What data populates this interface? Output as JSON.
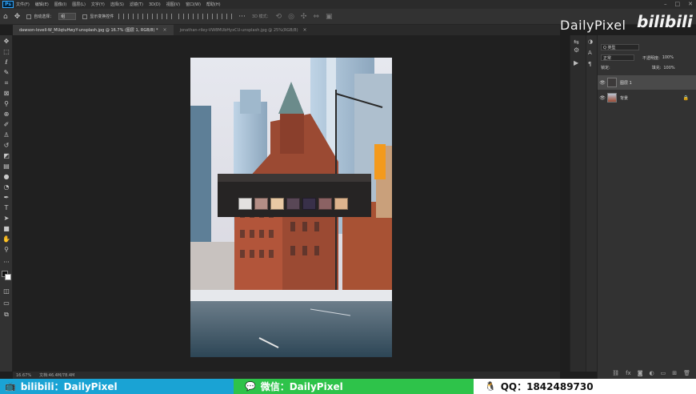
{
  "menubar": {
    "logo": "Ps",
    "items": [
      "文件(F)",
      "编辑(E)",
      "图像(I)",
      "图层(L)",
      "文字(Y)",
      "选择(S)",
      "滤镜(T)",
      "3D(D)",
      "视图(V)",
      "窗口(W)",
      "帮助(H)"
    ],
    "window_controls": [
      "–",
      "□",
      "✕"
    ]
  },
  "options": {
    "auto_select_label": "自动选择：",
    "auto_select_value": "组",
    "show_transform_label": "显示变换控件",
    "mode_3d_label": "3D 模式："
  },
  "watermark": {
    "brand": "DailyPixel",
    "bili": "bilibili"
  },
  "tabs": [
    {
      "label": "dawson-lovell-W_MUqtuHwyY-unsplash.jpg @ 16.7% (图层 1, RGB/8) *",
      "active": true
    },
    {
      "label": "jonathan-riley-VW8MUbHyxCU-unsplash.jpg @ 25%(RGB/8)",
      "active": false
    }
  ],
  "palette_colors": [
    "#e3e1e0",
    "#b48e86",
    "#e9c9a4",
    "#594756",
    "#383049",
    "#8b6263",
    "#ddb38d"
  ],
  "status": {
    "zoom": "16.67%",
    "doc": "文档:46.4M/78.4M"
  },
  "layers_panel": {
    "search_kind": "Q 类型",
    "blend_mode": "正常",
    "opacity_label": "不透明度:",
    "opacity_value": "100%",
    "lock_label": "锁定:",
    "fill_label": "填充:",
    "fill_value": "100%",
    "layers": [
      {
        "name": "图层 1",
        "selected": true
      },
      {
        "name": "背景",
        "selected": false
      }
    ],
    "footer_icons": [
      "link-icon",
      "fx-icon",
      "mask-icon",
      "adjustment-icon",
      "group-icon",
      "new-layer-icon",
      "trash-icon"
    ]
  },
  "banner": {
    "left": "bilibili：DailyPixel",
    "middle": "微信：DailyPixel",
    "right": "QQ：1842489730"
  }
}
